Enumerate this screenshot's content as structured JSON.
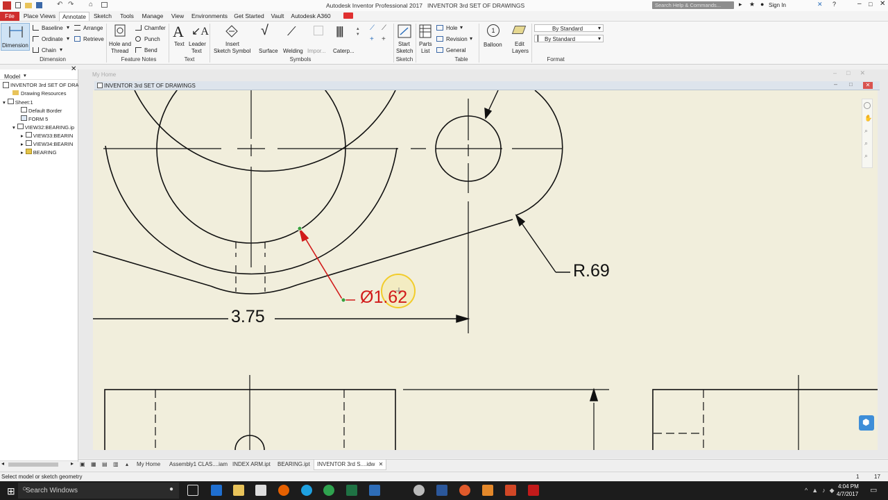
{
  "titlebar": {
    "app_title": "Autodesk Inventor Professional 2017",
    "doc_title": "INVENTOR 3rd SET OF DRAWINGS",
    "search_placeholder": "Search Help & Commands...",
    "sign_in": "Sign In"
  },
  "menu": {
    "items": [
      "File",
      "Place Views",
      "Annotate",
      "Sketch",
      "Tools",
      "Manage",
      "View",
      "Environments",
      "Get Started",
      "Vault",
      "Autodesk A360"
    ]
  },
  "ribbon": {
    "dimension": {
      "big": "Dimension",
      "baseline": "Baseline",
      "ordinate": "Ordinate",
      "chain": "Chain",
      "arrange": "Arrange",
      "retrieve": "Retrieve",
      "panel": "Dimension"
    },
    "feature_notes": {
      "hole_thread_1": "Hole and",
      "hole_thread_2": "Thread",
      "chamfer": "Chamfer",
      "punch": "Punch",
      "bend": "Bend",
      "panel": "Feature Notes"
    },
    "text": {
      "text": "Text",
      "leader_1": "Leader",
      "leader_2": "Text",
      "panel": "Text"
    },
    "symbols": {
      "insert_1": "Insert",
      "insert_2": "Sketch Symbol",
      "surface": "Surface",
      "welding": "Welding",
      "import": "Impor...",
      "caterpillar": "Caterp...",
      "panel": "Symbols"
    },
    "sketch": {
      "start_1": "Start",
      "start_2": "Sketch",
      "panel": "Sketch"
    },
    "table": {
      "parts_1": "Parts",
      "parts_2": "List",
      "hole": "Hole",
      "revision": "Revision",
      "general": "General",
      "panel": "Table"
    },
    "balloon": "Balloon",
    "edit_layers_1": "Edit",
    "edit_layers_2": "Layers",
    "format": {
      "style1": "By Standard",
      "style2": "By Standard",
      "panel": "Format"
    }
  },
  "browser": {
    "header": "Model",
    "items": [
      {
        "label": "INVENTOR 3rd SET OF DRAV"
      },
      {
        "label": "Drawing Resources"
      },
      {
        "label": "Sheet:1"
      },
      {
        "label": "Default Border"
      },
      {
        "label": "FORM 5"
      },
      {
        "label": "VIEW32:BEARING.ip"
      },
      {
        "label": "VIEW33:BEARIN"
      },
      {
        "label": "VIEW34:BEARIN"
      },
      {
        "label": "BEARING"
      }
    ]
  },
  "canvas": {
    "inner_title": "My Home",
    "doc_window_title": "INVENTOR 3rd SET OF DRAWINGS"
  },
  "drawing": {
    "dim_horizontal": "3.75",
    "dim_diameter": "Ø1.62",
    "dim_radius": "R.69"
  },
  "tabs": [
    "My Home",
    "Assembly1 CLAS....iam",
    "INDEX ARM.ipt",
    "BEARING.ipt",
    "INVENTOR 3rd S....idw"
  ],
  "status": {
    "message": "Select model or sketch geometry",
    "count1": "1",
    "count2": "17"
  },
  "taskbar": {
    "search": "Search Windows",
    "time": "4:04 PM",
    "date": "4/7/2017"
  },
  "colors": {
    "sheet": "#f1eedc",
    "accent_red": "#d11a1a",
    "ribbon_blue": "#2a6ebb"
  }
}
